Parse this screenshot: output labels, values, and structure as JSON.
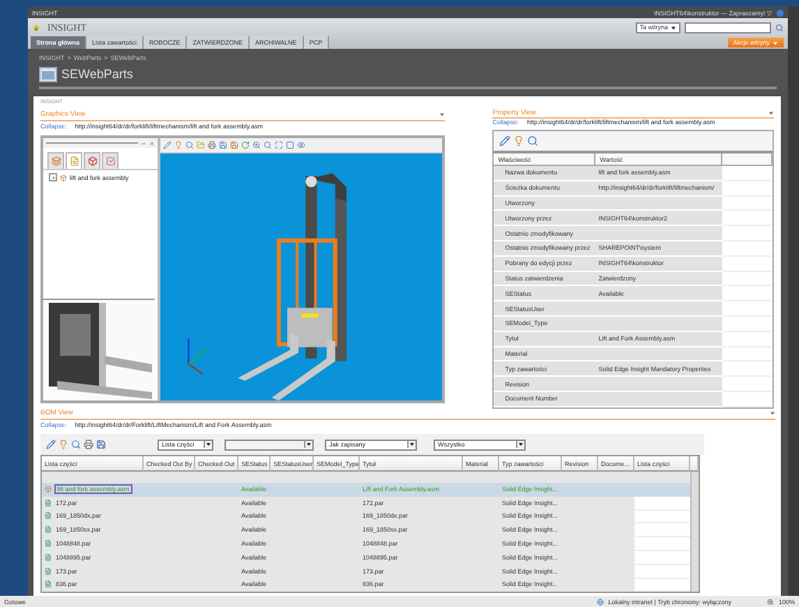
{
  "top_bar": {
    "site": "INSIGHT",
    "user": "INSIGHT64\\konstruktor — Zapraszamy! ▽"
  },
  "header": {
    "logo": "INSIGHT",
    "scope": "Ta witryna",
    "action": "Akcje witryny"
  },
  "tabs": [
    {
      "label": "Strona główna",
      "selected": true
    },
    {
      "label": "Lista zawartości",
      "selected": false
    },
    {
      "label": "ROBOCZE",
      "selected": false
    },
    {
      "label": "ZATWIERDZONE",
      "selected": false
    },
    {
      "label": "ARCHIWALNE",
      "selected": false
    },
    {
      "label": "PCP",
      "selected": false
    }
  ],
  "breadcrumb": {
    "items": [
      "INSIGHT",
      "WebParts",
      "SEWebParts"
    ],
    "separator": ">"
  },
  "page_title": "SEWebParts",
  "zone_label": "INSIGHT",
  "graphics_view": {
    "title": "Graphics View",
    "collapse": "Collapse:",
    "url": "http://insight64/dr/dr/forklift/liftmechanism/lift and fork assembly.asm",
    "pane_tabs": [
      {
        "selected": false
      },
      {
        "selected": true
      },
      {
        "selected": false
      },
      {
        "selected": false
      }
    ],
    "tree": [
      {
        "label": "lift and fork assembly",
        "expanded": false
      }
    ]
  },
  "property_view": {
    "title": "Property View",
    "collapse": "Collapse:",
    "url": "http://insight64/dr/dr/forklift/liftmechanism/lift and fork assembly.asm",
    "columns": [
      "Właściwość",
      "Wartość"
    ],
    "rows": [
      {
        "name": "Nazwa dokumentu",
        "value": "lift and fork assembly.asm"
      },
      {
        "name": "Ścieżka dokumentu",
        "value": "http://insight64/dr/dr/forklift/liftmechanism/"
      },
      {
        "name": "Utworzony"
      },
      {
        "name": "Utworzony przez",
        "value": "INSIGHT64\\konstruktor2"
      },
      {
        "name": "Ostatnio zmodyfikowany"
      },
      {
        "name": "Ostatnio zmodyfikowany przez",
        "value": "SHAREPOINT\\system"
      },
      {
        "name": "Pobrany do edycji przez",
        "value": "INSIGHT64\\konstruktor"
      },
      {
        "name": "Status zatwierdzenia",
        "value": "Zatwierdzony"
      },
      {
        "name": "SEStatus",
        "value": "Available"
      },
      {
        "name": "SEStatusUser"
      },
      {
        "name": "SEModel_Type"
      },
      {
        "name": "Tytuł",
        "value": "Lift and Fork Assembly.asm"
      },
      {
        "name": "Material"
      },
      {
        "name": "Typ zawartości",
        "value": "Solid Edge Insight Mandatory Properties"
      },
      {
        "name": "Revision"
      },
      {
        "name": "Document Number"
      }
    ]
  },
  "bom_view": {
    "title": "BOM View",
    "collapse": "Collapse:",
    "url": "http://insight64/dr/dr/Forklift/LiftMechanism/Lift and Fork Assembly.asm",
    "selects": [
      {
        "value": "Lista części",
        "disabled": false
      },
      {
        "disabled": true
      },
      {
        "value": "Jak zapisany",
        "disabled": false
      },
      {
        "value": "Wszystko",
        "disabled": false
      }
    ],
    "columns": [
      "Lista części",
      "Checked Out By",
      "Checked Out",
      "SEStatus",
      "SEStatusUser",
      "SEModel_Type",
      "Tytuł",
      "Material",
      "Typ zawartości",
      "Revision",
      "Docume...",
      "Lista części"
    ],
    "rows": [
      {
        "kind": "assembly",
        "name": "lift and fork assembly.asm",
        "status": "Available",
        "title": "Lift and Fork Assembly.asm",
        "type": "Solid Edge Insight...",
        "selected": true
      },
      {
        "kind": "part",
        "name": "172.par",
        "status": "Available",
        "title": "172.par",
        "type": "Solid Edge Insight...",
        "selected": false
      },
      {
        "kind": "part",
        "name": "169_1850dx.par",
        "status": "Available",
        "title": "169_1850dx.par",
        "type": "Solid Edge Insight...",
        "selected": false
      },
      {
        "kind": "part",
        "name": "169_1850sx.par",
        "status": "Available",
        "title": "169_1850sx.par",
        "type": "Solid Edge Insight...",
        "selected": false
      },
      {
        "kind": "part",
        "name": "1048848.par",
        "status": "Available",
        "title": "1048848.par",
        "type": "Solid Edge Insight...",
        "selected": false
      },
      {
        "kind": "part",
        "name": "1048895.par",
        "status": "Available",
        "title": "1048895.par",
        "type": "Solid Edge Insight...",
        "selected": false
      },
      {
        "kind": "part",
        "name": "173.par",
        "status": "Available",
        "title": "173.par",
        "type": "Solid Edge Insight...",
        "selected": false
      },
      {
        "kind": "part",
        "name": "836.par",
        "status": "Available",
        "title": "836.par",
        "type": "Solid Edge Insight...",
        "selected": false
      }
    ]
  },
  "status_bar": {
    "left": "Gotowe",
    "zone": "Lokalny intranet | Tryb chroniony: wyłączony",
    "zoom": "100%"
  }
}
